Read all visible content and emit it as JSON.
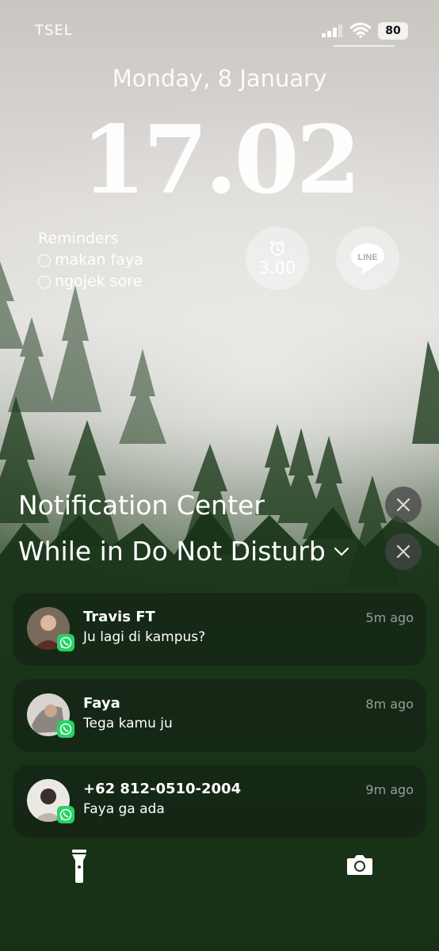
{
  "status_bar": {
    "carrier": "TSEL",
    "battery": "80"
  },
  "lock": {
    "date": "Monday, 8 January",
    "time": "17.02"
  },
  "reminders": {
    "title": "Reminders",
    "items": [
      "makan faya",
      "ngojek sore"
    ]
  },
  "widgets": {
    "alarm_time": "3.00",
    "line_label": "LINE"
  },
  "notification_center": {
    "title": "Notification Center",
    "dnd_title": "While in Do Not Disturb"
  },
  "notifications": [
    {
      "sender": "Travis FT",
      "message": "Ju lagi di kampus?",
      "time": "5m ago"
    },
    {
      "sender": "Faya",
      "message": "Tega kamu ju",
      "time": "8m ago"
    },
    {
      "sender": "+62 812-0510-2004",
      "message": "Faya ga ada",
      "time": "9m ago"
    }
  ],
  "colors": {
    "whatsapp": "#25D366"
  }
}
